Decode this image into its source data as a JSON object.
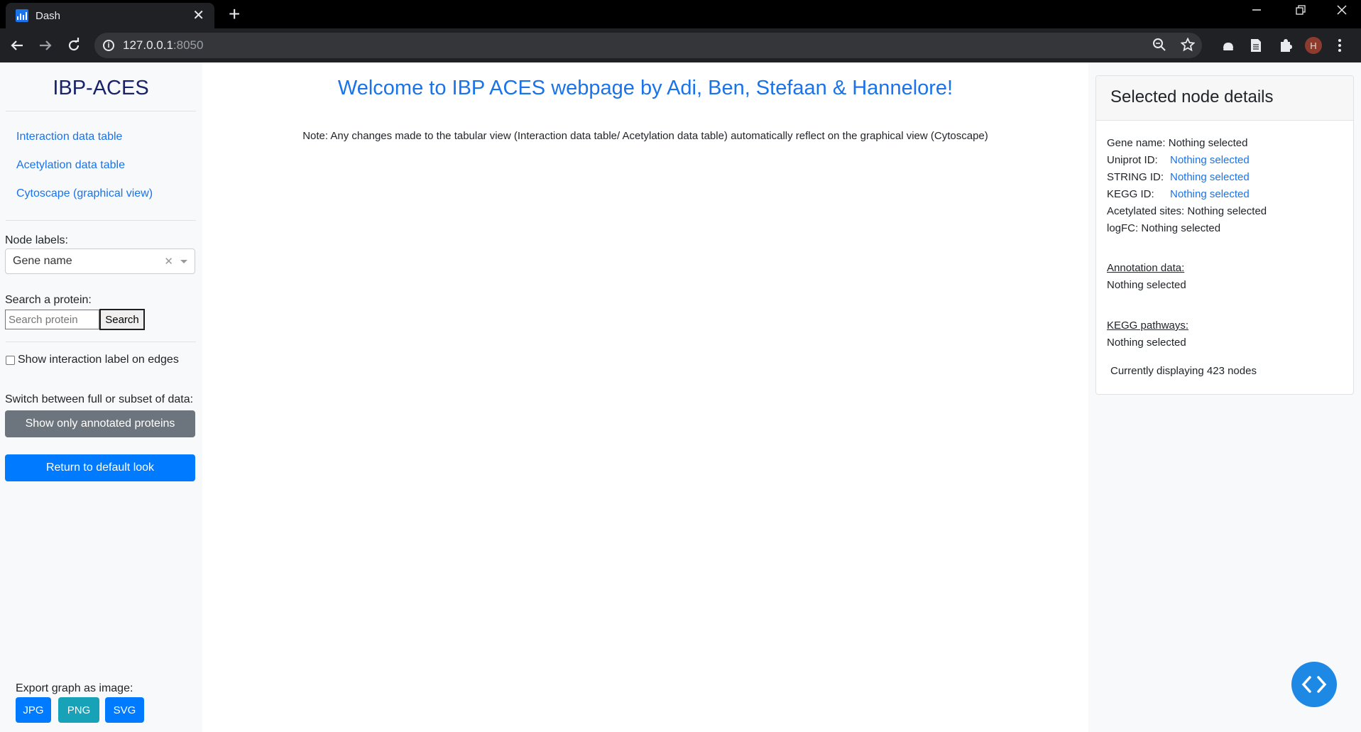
{
  "browser": {
    "tab_title": "Dash",
    "tab_close": "✕",
    "new_tab": "+",
    "url_host": "127.0.0.1",
    "url_port": ":8050",
    "avatar_letter": "H",
    "icons": [
      "back-arrow-icon",
      "forward-arrow-icon",
      "reload-icon",
      "site-info-icon",
      "zoom-icon",
      "bookmark-star-icon",
      "extension-icon",
      "reading-list-icon",
      "puzzle-extension-icon",
      "profile-avatar",
      "menu-icon",
      "minimize-icon",
      "restore-icon",
      "close-icon"
    ]
  },
  "sidebar": {
    "brand": "IBP-ACES",
    "links": [
      "Interaction data table",
      "Acetylation data table",
      "Cytoscape (graphical view)"
    ],
    "node_labels_label": "Node labels:",
    "node_labels_value": "Gene name",
    "search_label": "Search a protein:",
    "search_placeholder": "Search protein",
    "search_button": "Search",
    "edge_label_checkbox": "Show interaction label on edges",
    "switch_label": "Switch between full or subset of data:",
    "annotated_button": "Show only annotated proteins",
    "default_look_button": "Return to default look",
    "export_label": "Export graph as image:",
    "export_buttons": [
      "JPG",
      "PNG",
      "SVG"
    ]
  },
  "main": {
    "title": "Welcome to IBP ACES webpage by Adi, Ben, Stefaan & Hannelore!",
    "note": "Note: Any changes made to the tabular view (Interaction data table/ Acetylation data table) automatically reflect on the graphical view (Cytoscape)"
  },
  "details": {
    "title": "Selected node details",
    "gene_label": "Gene name:",
    "gene_value": "Nothing selected",
    "uniprot_label": "Uniprot ID:",
    "uniprot_value": "Nothing selected",
    "string_label": "STRING ID:",
    "string_value": "Nothing selected",
    "kegg_label": "KEGG ID:",
    "kegg_value": "Nothing selected",
    "acetyl_label": "Acetylated sites:",
    "acetyl_value": "Nothing selected",
    "logfc_label": "logFC:",
    "logfc_value": "Nothing selected",
    "annotation_heading": "Annotation data:",
    "annotation_value": "Nothing selected",
    "pathways_heading": "KEGG pathways:",
    "pathways_value": "Nothing selected",
    "display_count": "Currently displaying 423 nodes"
  },
  "colors": {
    "accent_blue": "#1a73e8",
    "button_blue": "#007bff",
    "button_grey": "#6c757d",
    "export_jpg": "#007bff",
    "export_png": "#17a2b8",
    "export_svg": "#007bff",
    "brand_navy": "#19236b"
  }
}
